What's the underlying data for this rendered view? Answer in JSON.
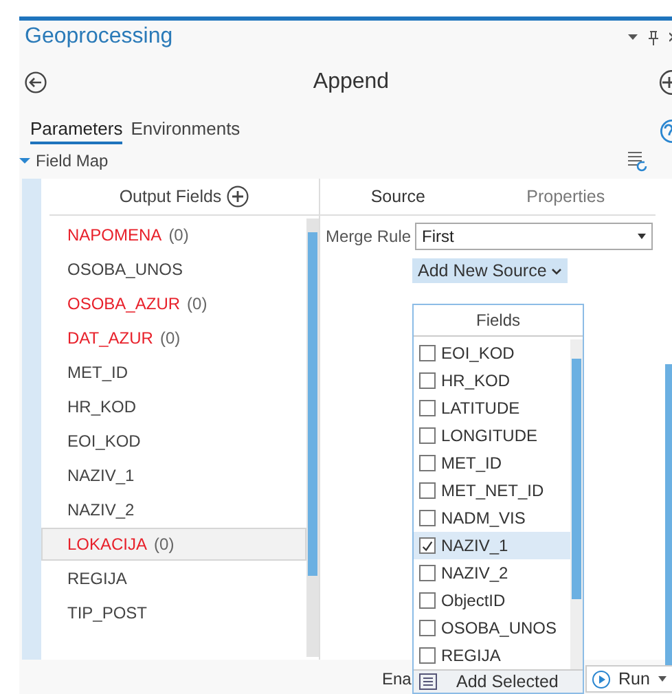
{
  "panel": {
    "title": "Geoprocessing"
  },
  "tool": {
    "title": "Append"
  },
  "tabs": [
    {
      "label": "Parameters",
      "selected": true
    },
    {
      "label": "Environments",
      "selected": false
    }
  ],
  "field_map": {
    "title": "Field Map"
  },
  "output_fields": {
    "header": "Output Fields",
    "items": [
      {
        "name": "NAPOMENA",
        "count": "(0)",
        "error": true,
        "selected": false
      },
      {
        "name": "OSOBA_UNOS",
        "error": false,
        "selected": false
      },
      {
        "name": "OSOBA_AZUR",
        "count": "(0)",
        "error": true,
        "selected": false
      },
      {
        "name": "DAT_AZUR",
        "count": "(0)",
        "error": true,
        "selected": false
      },
      {
        "name": "MET_ID",
        "error": false,
        "selected": false
      },
      {
        "name": "HR_KOD",
        "error": false,
        "selected": false
      },
      {
        "name": "EOI_KOD",
        "error": false,
        "selected": false
      },
      {
        "name": "NAZIV_1",
        "error": false,
        "selected": false
      },
      {
        "name": "NAZIV_2",
        "error": false,
        "selected": false
      },
      {
        "name": "LOKACIJA",
        "count": "(0)",
        "error": true,
        "selected": true
      },
      {
        "name": "REGIJA",
        "error": false,
        "selected": false
      },
      {
        "name": "TIP_POST",
        "error": false,
        "selected": false
      }
    ]
  },
  "source_tabs": [
    {
      "label": "Source",
      "selected": true
    },
    {
      "label": "Properties",
      "selected": false
    }
  ],
  "merge_rule": {
    "label": "Merge Rule",
    "value": "First"
  },
  "add_source": {
    "label": "Add New Source"
  },
  "fields_popup": {
    "header": "Fields",
    "button": "Add Selected",
    "items": [
      {
        "label": "EOI_KOD",
        "checked": false,
        "selected": false
      },
      {
        "label": "HR_KOD",
        "checked": false,
        "selected": false
      },
      {
        "label": "LATITUDE",
        "checked": false,
        "selected": false
      },
      {
        "label": "LONGITUDE",
        "checked": false,
        "selected": false
      },
      {
        "label": "MET_ID",
        "checked": false,
        "selected": false
      },
      {
        "label": "MET_NET_ID",
        "checked": false,
        "selected": false
      },
      {
        "label": "NADM_VIS",
        "checked": false,
        "selected": false
      },
      {
        "label": "NAZIV_1",
        "checked": true,
        "selected": true
      },
      {
        "label": "NAZIV_2",
        "checked": false,
        "selected": false
      },
      {
        "label": "ObjectID",
        "checked": false,
        "selected": false
      },
      {
        "label": "OSOBA_UNOS",
        "checked": false,
        "selected": false
      },
      {
        "label": "REGIJA",
        "checked": false,
        "selected": false
      }
    ]
  },
  "bottom": {
    "label": "Ena",
    "run": "Run"
  }
}
